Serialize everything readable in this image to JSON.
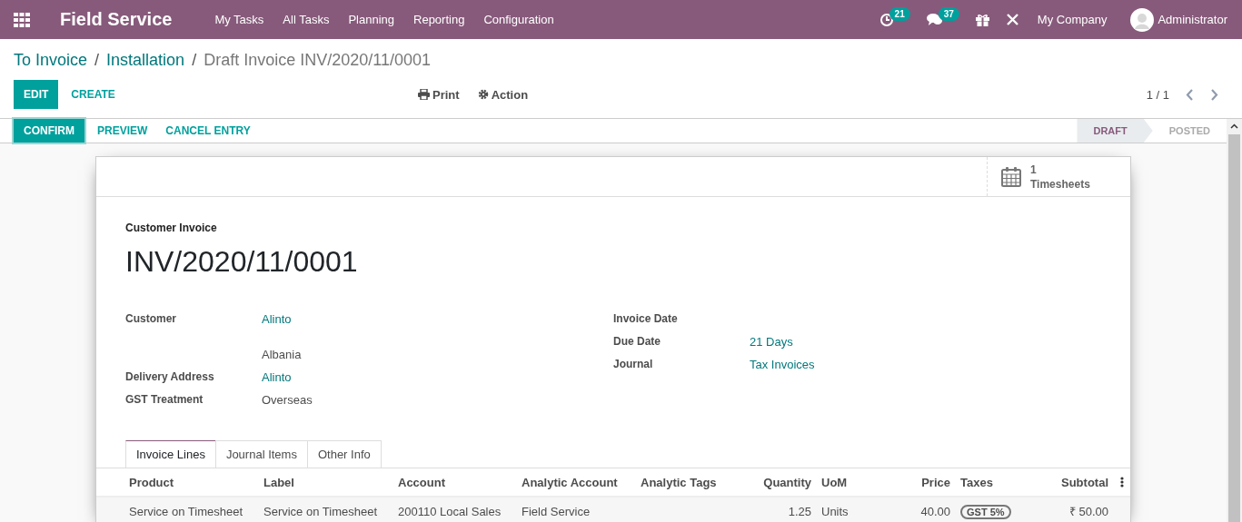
{
  "navbar": {
    "app_title": "Field Service",
    "menu": [
      "My Tasks",
      "All Tasks",
      "Planning",
      "Reporting",
      "Configuration"
    ],
    "activity_count": "21",
    "message_count": "37",
    "company": "My Company",
    "user": "Administrator"
  },
  "breadcrumbs": [
    {
      "label": "To Invoice",
      "kind": "link"
    },
    {
      "label": "/",
      "kind": "separator"
    },
    {
      "label": "Installation",
      "kind": "link"
    },
    {
      "label": "/",
      "kind": "separator"
    },
    {
      "label": "Draft Invoice INV/2020/11/0001",
      "kind": "current"
    }
  ],
  "buttons": [
    {
      "label": "EDIT",
      "kind": "primary"
    },
    {
      "label": "CREATE",
      "kind": "link"
    }
  ],
  "actions": [
    {
      "label": "Print",
      "kind": "print"
    },
    {
      "label": "Action",
      "kind": "gear"
    }
  ],
  "pager": "1 / 1",
  "header_buttons": [
    {
      "label": "CONFIRM",
      "kind": "primary"
    },
    {
      "label": "PREVIEW",
      "kind": "link"
    },
    {
      "label": "CANCEL ENTRY",
      "kind": "link"
    }
  ],
  "stages": [
    {
      "label": "DRAFT",
      "selected": true
    },
    {
      "label": "POSTED",
      "selected": false
    }
  ],
  "smart_button": {
    "count": "1",
    "label": "Timesheets"
  },
  "document_type": "Customer Invoice",
  "number": "INV/2020/11/0001",
  "left_fields": [
    {
      "label": "Customer",
      "value": "Alinto",
      "kind": "link",
      "address": [
        "Albania"
      ]
    },
    {
      "label": "Delivery Address",
      "value": "Alinto",
      "kind": "link"
    },
    {
      "label": "GST Treatment",
      "value": "Overseas",
      "kind": "text"
    }
  ],
  "right_fields": [
    {
      "label": "Invoice Date"
    },
    {
      "label": "Due Date",
      "value": "21 Days",
      "kind": "link"
    },
    {
      "label": "Journal",
      "value": "Tax Invoices",
      "kind": "link"
    }
  ],
  "tabs": [
    {
      "label": "Invoice Lines",
      "selected": true
    },
    {
      "label": "Journal Items",
      "selected": false
    },
    {
      "label": "Other Info",
      "selected": false
    }
  ],
  "columns": [
    {
      "label": "Product",
      "numeric": false
    },
    {
      "label": "Label",
      "numeric": false
    },
    {
      "label": "Account",
      "numeric": false
    },
    {
      "label": "Analytic Account",
      "numeric": false
    },
    {
      "label": "Analytic Tags",
      "numeric": false
    },
    {
      "label": "Quantity",
      "numeric": true
    },
    {
      "label": "UoM",
      "numeric": false
    },
    {
      "label": "Price",
      "numeric": true
    },
    {
      "label": "Taxes",
      "numeric": false
    },
    {
      "label": "Subtotal",
      "numeric": true
    }
  ],
  "rows": [
    {
      "product": "Service on Timesheet",
      "label": "Service on Timesheet",
      "account": "200110 Local Sales",
      "analytic_account": "Field Service",
      "quantity": "1.25",
      "uom": "Units",
      "price": "40.00",
      "taxes": [
        "GST 5%"
      ],
      "subtotal": "₹ 50.00"
    }
  ]
}
